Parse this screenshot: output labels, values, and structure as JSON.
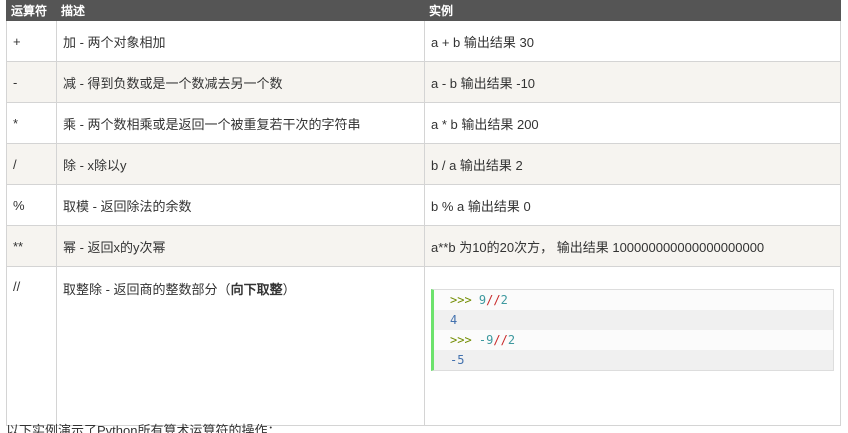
{
  "table": {
    "headers": [
      "运算符",
      "描述",
      "实例"
    ],
    "rows": [
      {
        "op": "+",
        "desc": "加 - 两个对象相加",
        "example": "a + b 输出结果 30"
      },
      {
        "op": "-",
        "desc": "减 - 得到负数或是一个数减去另一个数",
        "example": "a - b 输出结果 -10"
      },
      {
        "op": "*",
        "desc": "乘 - 两个数相乘或是返回一个被重复若干次的字符串",
        "example": "a * b 输出结果 200"
      },
      {
        "op": "/",
        "desc": "除 - x除以y",
        "example": "b / a 输出结果 2"
      },
      {
        "op": "%",
        "desc": "取模 - 返回除法的余数",
        "example": "b % a 输出结果 0"
      },
      {
        "op": "**",
        "desc": "幂 - 返回x的y次幂",
        "example": "a**b 为10的20次方， 输出结果 100000000000000000000"
      },
      {
        "op": "//",
        "desc_prefix": "取整除 - 返回商的整数部分（",
        "desc_bold": "向下取整",
        "desc_suffix": "）"
      }
    ]
  },
  "code_example": {
    "line1_prompt": ">>>",
    "line1_num": "9",
    "line1_op": "//",
    "line1_num2": "2",
    "line2_out": "4",
    "line3_prompt": ">>>",
    "line3_num": "-9",
    "line3_op": "//",
    "line3_num2": "2",
    "line4_out": "-5"
  },
  "caption": "以下实例演示了Python所有算术运算符的操作："
}
